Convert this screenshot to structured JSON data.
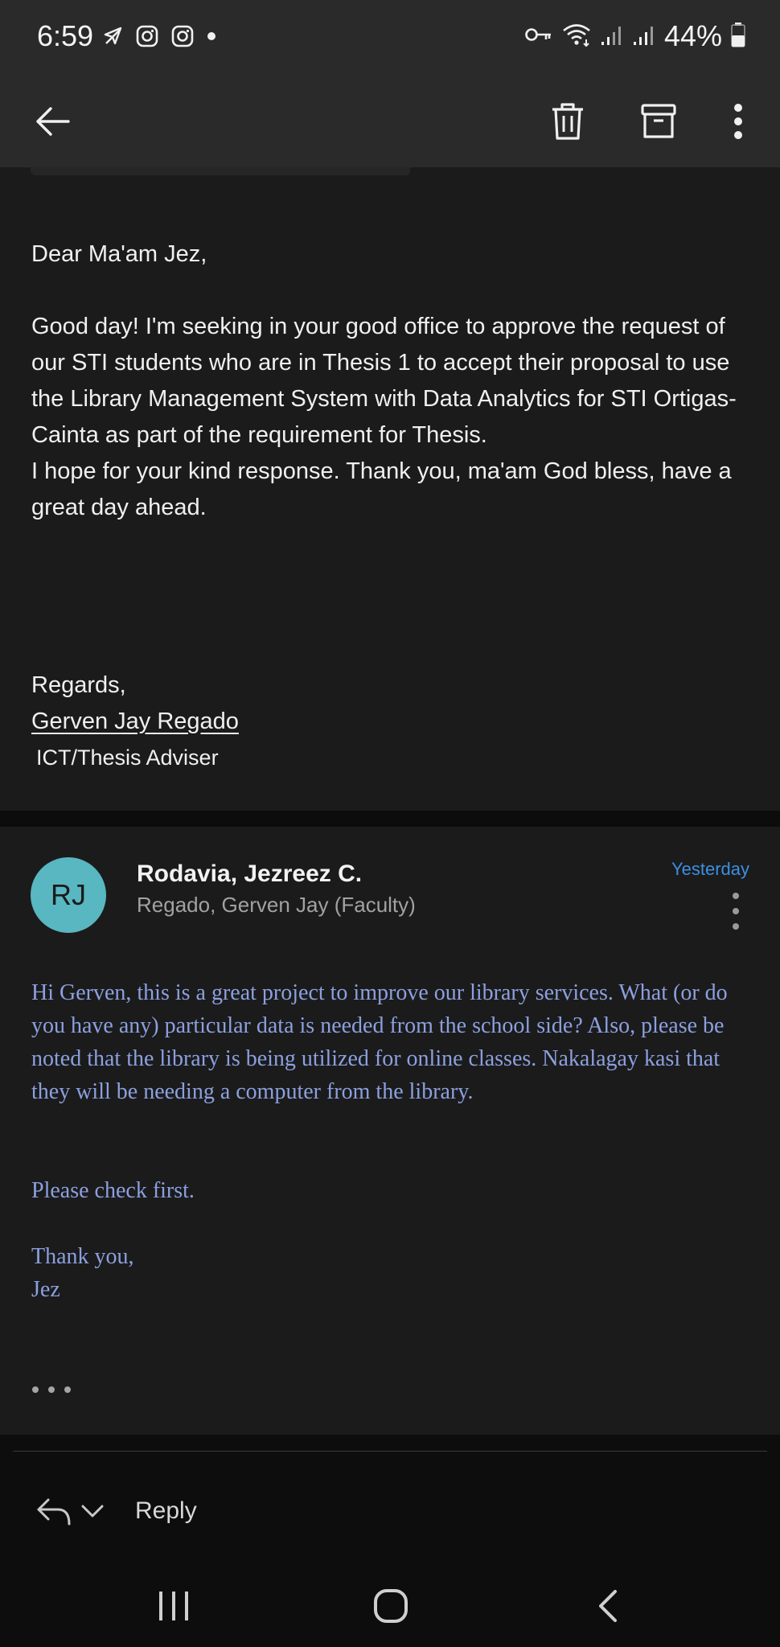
{
  "status_bar": {
    "time": "6:59",
    "battery": "44%",
    "left_icons": [
      "navigation-icon",
      "instagram-icon",
      "instagram-icon",
      "dot-icon"
    ],
    "right_icons": [
      "vpn-key-icon",
      "wifi-icon",
      "signal-icon",
      "signal-icon",
      "battery-icon"
    ]
  },
  "toolbar": {
    "back": "back-arrow-icon",
    "delete": "trash-icon",
    "archive": "archive-icon",
    "more": "more-vertical-icon"
  },
  "message1": {
    "greeting": "Dear Ma'am Jez,",
    "body": "Good day! I'm seeking in your good office to approve the request of our STI students who are in Thesis 1 to accept their proposal to use the Library Management System with Data Analytics for STI Ortigas-Cainta as part of the requirement for Thesis.\nI hope for your kind response. Thank you, ma'am God bless, have a great day ahead.",
    "closing": "Regards,",
    "signature_name": "Gerven Jay Regado",
    "signature_role": "ICT/Thesis Adviser"
  },
  "message2": {
    "avatar_initials": "RJ",
    "avatar_color": "#58b7c0",
    "sender": "Rodavia, Jezreez C.",
    "recipient": "Regado, Gerven Jay (Faculty)",
    "date": "Yesterday",
    "body_paragraph": "Hi Gerven, this is a great project to improve our library services. What (or do you have any) particular data is needed from the school side? Also, please be noted that the library is being utilized for online classes. Nakalagay kasi that they will be needing a computer from the library.",
    "check": "Please check first.",
    "thanks": "Thank you,\nJez",
    "text_color": "#8ca0de"
  },
  "reply": {
    "label": "Reply"
  },
  "colors": {
    "background": "#1b1b1c",
    "bar": "#2a2a2b",
    "accent_date": "#3d8fe0"
  }
}
